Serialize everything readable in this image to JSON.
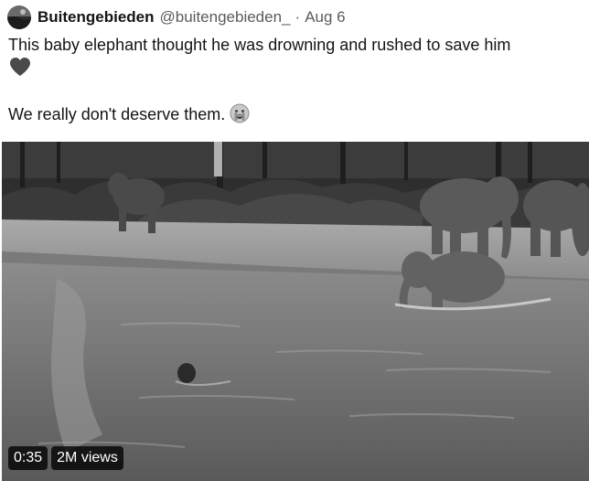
{
  "tweet": {
    "display_name": "Buitengebieden",
    "handle": "@buitengebieden_",
    "separator": "·",
    "date": "Aug 6",
    "text_line1": "This baby elephant thought he was drowning and rushed to save him",
    "text_line2": "We really don't deserve them.",
    "icons": {
      "avatar": "profile-avatar",
      "heart": "heart-emoji",
      "emoji": "crying-face-emoji"
    }
  },
  "video": {
    "duration": "0:35",
    "views": "2M views"
  },
  "colors": {
    "text": "#141414",
    "secondary": "#5b5b5b",
    "badge_bg": "#000000"
  }
}
